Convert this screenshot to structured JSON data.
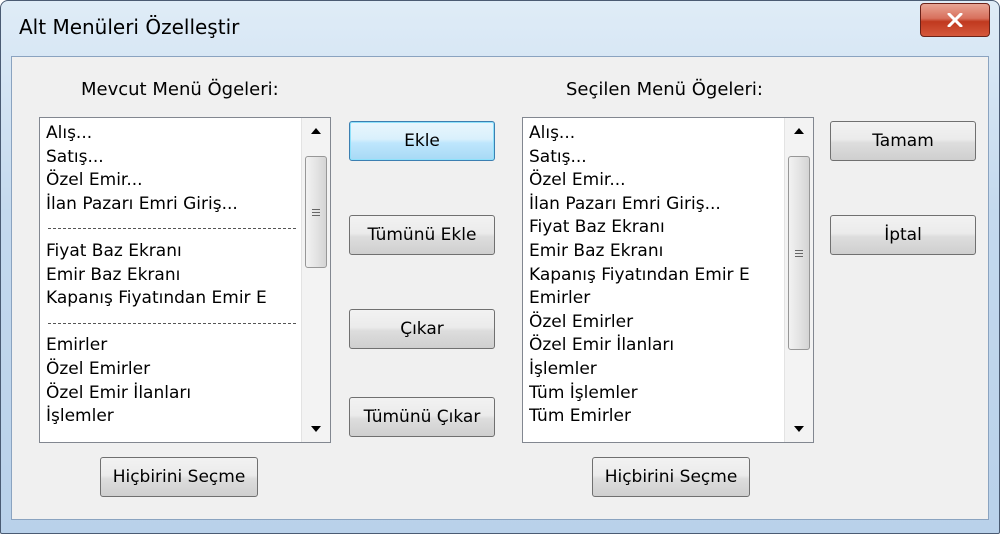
{
  "window": {
    "title": "Alt Menüleri Özelleştir"
  },
  "available": {
    "label": "Mevcut Menü Ögeleri:",
    "items": [
      "Alış...",
      "Satış...",
      "Özel Emir...",
      "İlan Pazarı Emri Giriş...",
      "",
      "Fiyat Baz Ekranı",
      "Emir Baz Ekranı",
      "Kapanış Fiyatından Emir E",
      "",
      "Emirler",
      "Özel Emirler",
      "Özel Emir İlanları",
      "İşlemler"
    ],
    "separator_indices": [
      4,
      8
    ],
    "none_button": "Hiçbirini Seçme"
  },
  "selected": {
    "label": "Seçilen Menü Ögeleri:",
    "items": [
      "Alış...",
      "Satış...",
      "Özel Emir...",
      "İlan Pazarı Emri Giriş...",
      "Fiyat Baz Ekranı",
      "Emir Baz Ekranı",
      "Kapanış Fiyatından Emir E",
      "Emirler",
      "Özel Emirler",
      "Özel Emir İlanları",
      "İşlemler",
      "Tüm İşlemler",
      "Tüm Emirler"
    ],
    "none_button": "Hiçbirini Seçme"
  },
  "actions": {
    "add": "Ekle",
    "add_all": "Tümünü Ekle",
    "remove": "Çıkar",
    "remove_all": "Tümünü Çıkar"
  },
  "dialog_buttons": {
    "ok": "Tamam",
    "cancel": "İptal"
  },
  "icons": {
    "close": "close-icon",
    "scroll_up": "arrow-up-icon",
    "scroll_down": "arrow-down-icon",
    "scroll_grip": "grip-icon"
  },
  "colors": {
    "default_button_border": "#3c7fb1",
    "close_button": "#c0391f",
    "client_bg": "#f0f0f0"
  }
}
